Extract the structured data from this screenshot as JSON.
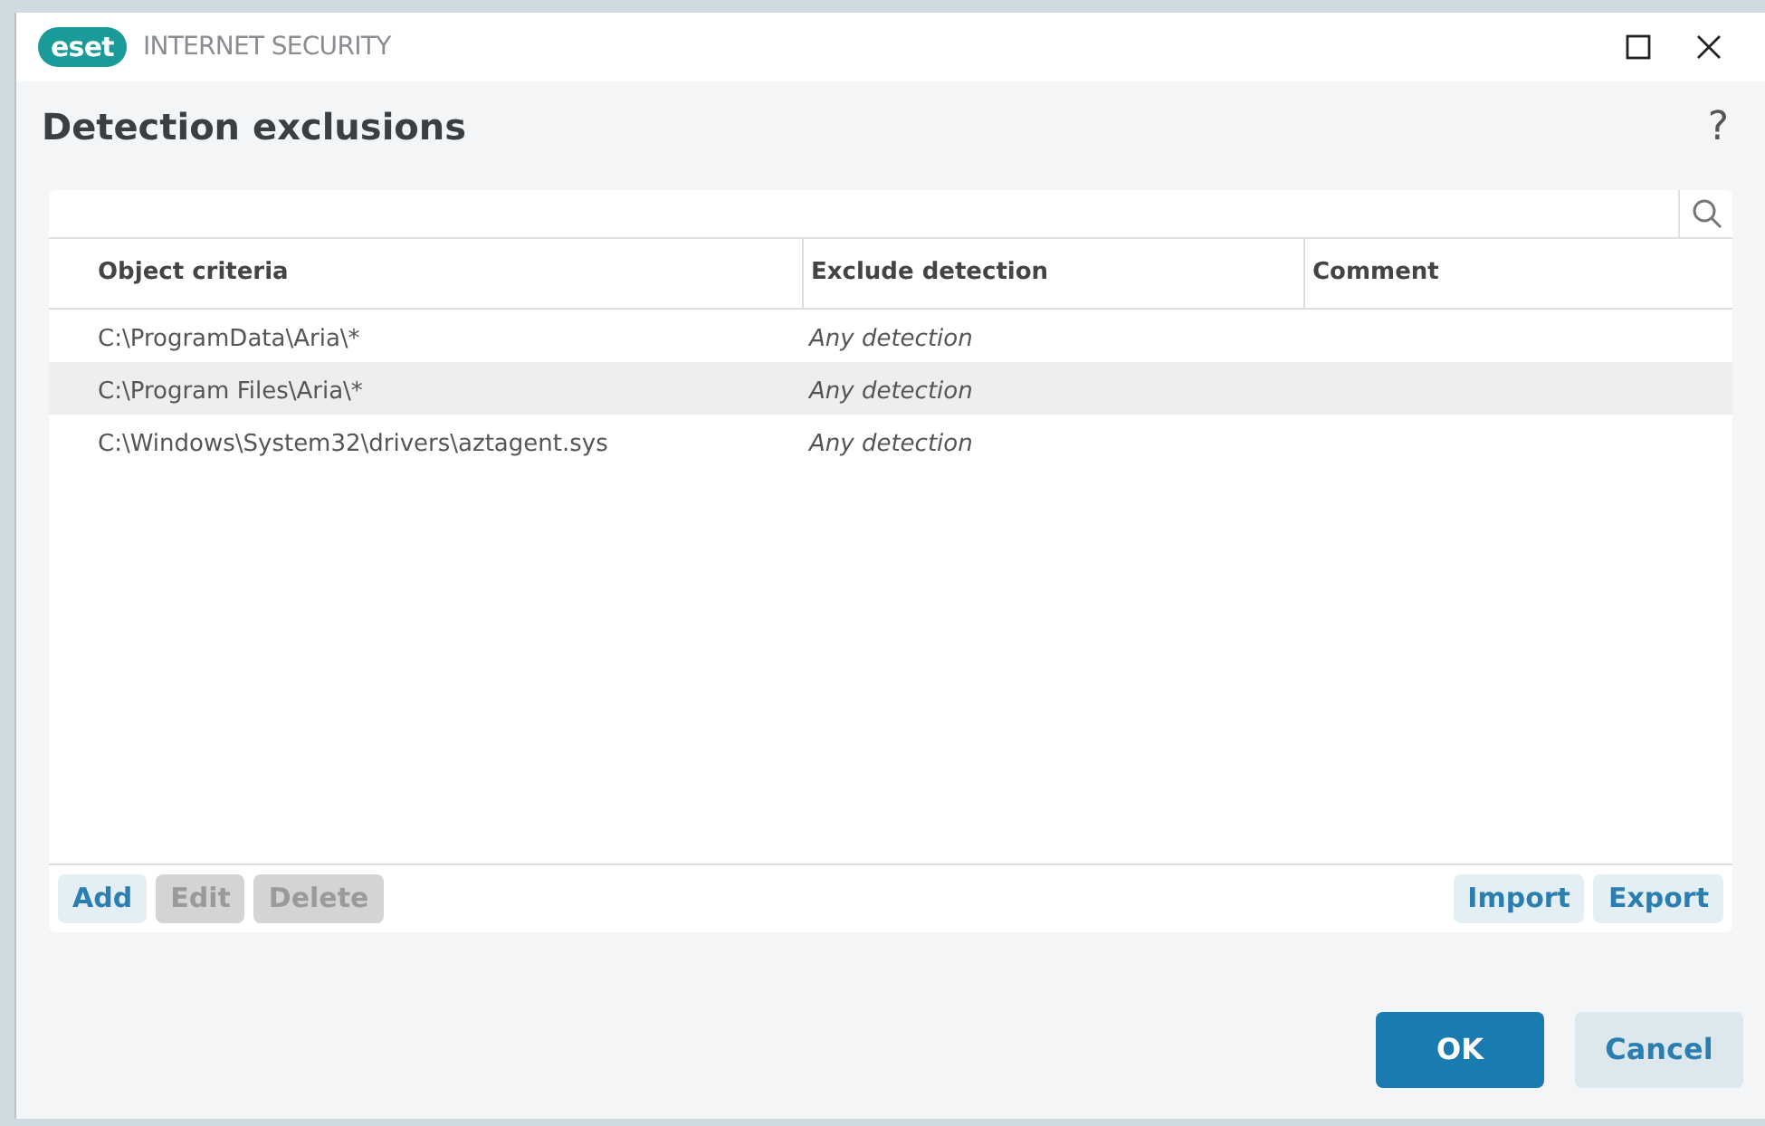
{
  "window": {
    "logo": "eset",
    "product": "INTERNET SECURITY"
  },
  "dialog": {
    "title": "Detection exclusions",
    "help": "?"
  },
  "table": {
    "columns": [
      "Object criteria",
      "Exclude detection",
      "Comment"
    ],
    "rows": [
      {
        "cells": [
          "C:\\ProgramData\\Aria\\*",
          "Any detection",
          ""
        ],
        "selected": false
      },
      {
        "cells": [
          "C:\\Program Files\\Aria\\*",
          "Any detection",
          ""
        ],
        "selected": true
      },
      {
        "cells": [
          "C:\\Windows\\System32\\drivers\\aztagent.sys",
          "Any detection",
          ""
        ],
        "selected": false
      }
    ]
  },
  "list_buttons_left": [
    {
      "label": "Add",
      "disabled": false
    },
    {
      "label": "Edit",
      "disabled": true
    },
    {
      "label": "Delete",
      "disabled": true
    }
  ],
  "list_buttons_right": [
    {
      "label": "Import",
      "disabled": false
    },
    {
      "label": "Export",
      "disabled": false
    }
  ],
  "footer_buttons": [
    {
      "label": "OK",
      "kind": "primary"
    },
    {
      "label": "Cancel",
      "kind": "secondary"
    }
  ]
}
